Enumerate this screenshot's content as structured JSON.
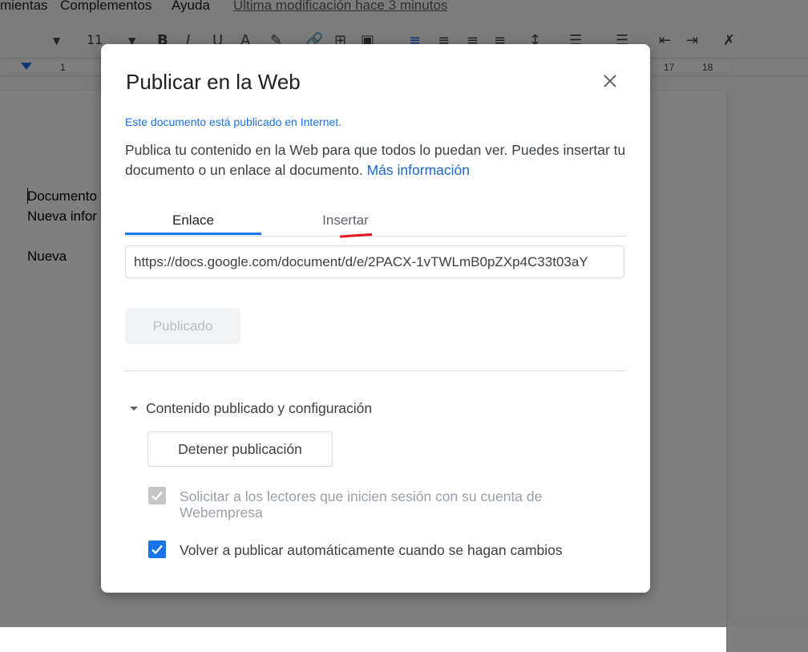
{
  "app": {
    "menu": [
      "mientas",
      "Complementos",
      "Ayuda"
    ],
    "last_modified": "Última modificación hace 3 minutos",
    "toolbar": {
      "font_size": "11",
      "bold": "B",
      "italic": "I",
      "underline": "U",
      "text_color": "A"
    },
    "ruler": {
      "tick_1": "1",
      "tick_17": "17",
      "tick_18": "18"
    },
    "document_lines": [
      "Documento",
      "Nueva infor",
      "Nueva"
    ]
  },
  "dialog": {
    "title": "Publicar en la Web",
    "status_note": "Este documento está publicado en Internet.",
    "description": "Publica tu contenido en la Web para que todos lo puedan ver. Puedes insertar tu documento o un enlace al documento.",
    "more_info_link": "Más información",
    "tabs": [
      {
        "label": "Enlace",
        "active": true
      },
      {
        "label": "Insertar",
        "active": false
      }
    ],
    "url_value": "https://docs.google.com/document/d/e/2PACX-1vTWLmB0pZXp4C33t03aY",
    "publish_button": "Publicado",
    "section_title": "Contenido publicado y configuración",
    "stop_button": "Detener publicación",
    "checkboxes": [
      {
        "label": "Solicitar a los lectores que inicien sesión con su cuenta de Webempresa",
        "checked": true,
        "disabled": true
      },
      {
        "label": "Volver a publicar automáticamente cuando se hagan cambios",
        "checked": true,
        "disabled": false
      }
    ],
    "colors": {
      "accent": "#1a73e8",
      "link": "#1967d2",
      "annotation": "#e8141e"
    }
  }
}
